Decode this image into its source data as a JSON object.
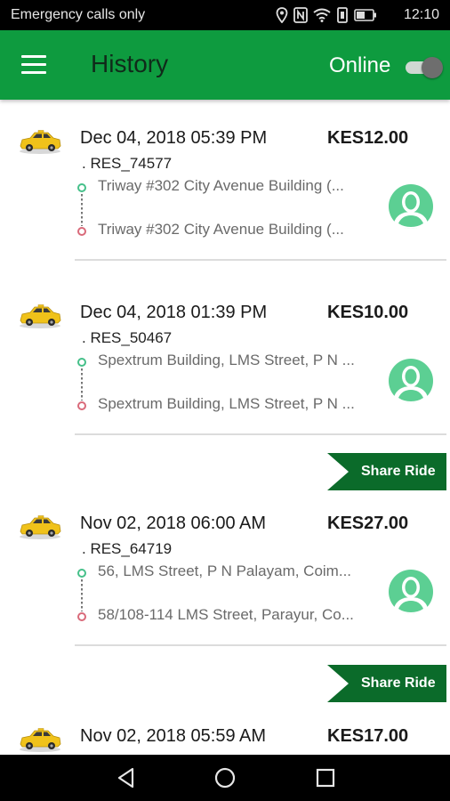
{
  "status_bar": {
    "carrier_text": "Emergency calls only",
    "time": "12:10",
    "icons": [
      "location-icon",
      "nfc-icon",
      "wifi-icon",
      "vibrate-icon",
      "battery-icon"
    ]
  },
  "app_bar": {
    "title": "History",
    "online_label": "Online",
    "online_toggle_on": true,
    "background_color": "#0e9b3f"
  },
  "rides": [
    {
      "date": "Dec 04, 2018 05:39 PM",
      "fare": "KES12.00",
      "ref": ". RES_74577",
      "pickup": "Triway #302 City Avenue Building (...",
      "drop": "Triway #302 City Avenue Building (..."
    },
    {
      "date": "Dec 04, 2018 01:39 PM",
      "fare": "KES10.00",
      "ref": ". RES_50467",
      "pickup": "Spextrum Building, LMS Street, P N ...",
      "drop": "Spextrum Building, LMS Street, P N ..."
    },
    {
      "date": "Nov 02, 2018 06:00 AM",
      "fare": "KES27.00",
      "ref": ". RES_64719",
      "pickup": "56, LMS Street, P N Palayam, Coim...",
      "drop": "58/108-114 LMS Street, Parayur, Co..."
    },
    {
      "date": "Nov 02, 2018 05:59 AM",
      "fare": "KES17.00",
      "ref": "",
      "pickup": "",
      "drop": ""
    }
  ],
  "share_ride_label": "Share Ride",
  "colors": {
    "pickup_dot": "#46c08a",
    "drop_dot": "#d96a7a",
    "avatar": "#5ccf93",
    "share_button": "#0b6b2a"
  },
  "nav_bar": {
    "icons": [
      "back-icon",
      "home-icon",
      "recents-icon"
    ]
  }
}
